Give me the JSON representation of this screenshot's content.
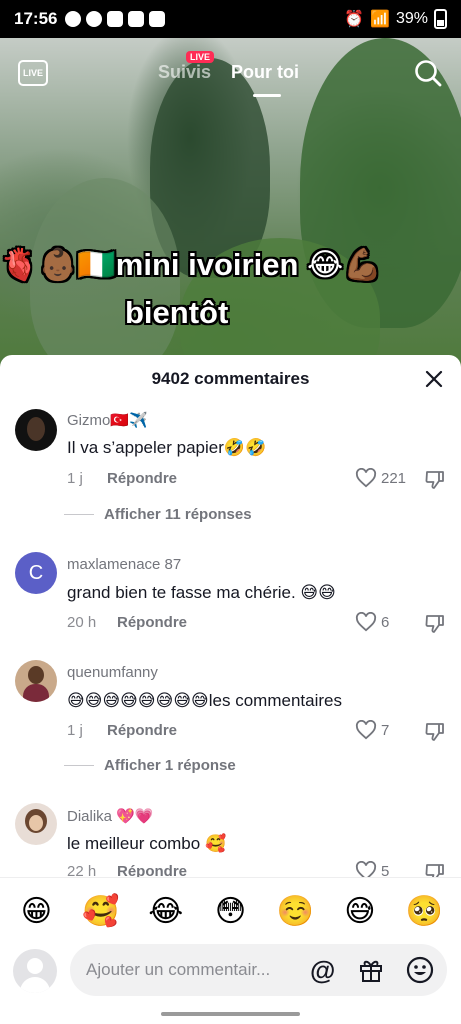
{
  "status_bar": {
    "time": "17:56",
    "battery": "39%"
  },
  "video": {
    "live_icon_label": "LIVE",
    "tabs": [
      {
        "label": "Suivis"
      },
      {
        "label": "Pour toi"
      }
    ],
    "live_badge": "LIVE",
    "caption_line1": "🫀👶🏾🇨🇮mini ivoirien 😂💪🏾",
    "caption_line2": "bientôt"
  },
  "sheet": {
    "title": "9402 commentaires",
    "comments": [
      {
        "user": "Gizmo🇹🇷✈️",
        "text": "Il va s’appeler papier🤣🤣",
        "time": "1 j",
        "reply": "Répondre",
        "likes": "221",
        "more": "Afficher 11 réponses"
      },
      {
        "user": "maxlamenace 87",
        "text": "grand bien te fasse ma chérie. 😅😅",
        "time": "20 h",
        "reply": "Répondre",
        "likes": "6",
        "avatar_letter": "C"
      },
      {
        "user": "quenumfanny",
        "text": "😅😅😅😅😅😅😅😅les commentaires",
        "time": "1 j",
        "reply": "Répondre",
        "likes": "7",
        "more": "Afficher 1 réponse"
      },
      {
        "user": "Dialika 💖💗",
        "text": "le meilleur combo 🥰",
        "time": "22 h",
        "reply": "Répondre",
        "likes": "5"
      }
    ]
  },
  "emoji_bar": [
    "😁",
    "🥰",
    "😂",
    "😳",
    "☺️",
    "😅",
    "🥺"
  ],
  "input": {
    "placeholder": "Ajouter un commentair..."
  },
  "colors": {
    "accent": "#fe2c55",
    "text": "#161823",
    "muted": "#73757c",
    "avatar_c": "#5b5fc7"
  }
}
